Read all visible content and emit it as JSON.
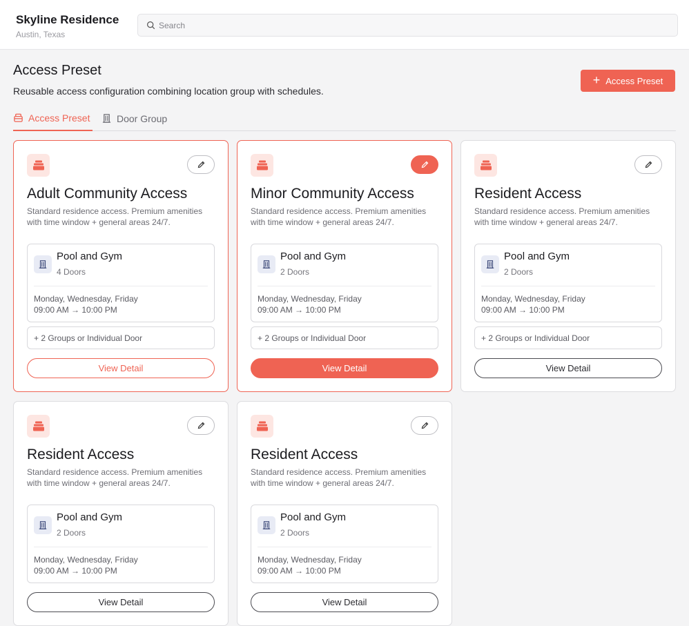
{
  "header": {
    "title": "Skyline Residence",
    "subtitle": "Austin, Texas",
    "search_placeholder": "Search"
  },
  "page": {
    "title": "Access Preset",
    "description": "Reusable access configuration combining location group with schedules.",
    "add_button_label": "Access Preset"
  },
  "tabs": [
    {
      "label": "Access Preset",
      "active": true
    },
    {
      "label": "Door Group",
      "active": false
    }
  ],
  "colors": {
    "accent": "#ef6353",
    "accent_soft": "#fde6e2"
  },
  "cards": [
    {
      "title": "Adult Community Access",
      "description": "Standard residence access. Premium amenities with time window + general areas 24/7.",
      "group_name": "Pool and Gym",
      "group_doors": "4 Doors",
      "schedule_days": "Monday, Wednesday, Friday",
      "schedule_time": "09:00 AM → 10:00 PM",
      "more": "+ 2 Groups or Individual Door",
      "detail_label": "View Detail"
    },
    {
      "title": "Minor Community Access",
      "description": "Standard residence access. Premium amenities with time window + general areas 24/7.",
      "group_name": "Pool and Gym",
      "group_doors": "2 Doors",
      "schedule_days": "Monday, Wednesday, Friday",
      "schedule_time": "09:00 AM → 10:00 PM",
      "more": "+ 2 Groups or Individual Door",
      "detail_label": "View Detail"
    },
    {
      "title": "Resident Access",
      "description": "Standard residence access. Premium amenities with time window + general areas 24/7.",
      "group_name": "Pool and Gym",
      "group_doors": "2 Doors",
      "schedule_days": "Monday, Wednesday, Friday",
      "schedule_time": "09:00 AM → 10:00 PM",
      "more": "+ 2 Groups or Individual Door",
      "detail_label": "View Detail"
    },
    {
      "title": "Resident Access",
      "description": "Standard residence access. Premium amenities with time window + general areas 24/7.",
      "group_name": "Pool and Gym",
      "group_doors": "2 Doors",
      "schedule_days": "Monday, Wednesday, Friday",
      "schedule_time": "09:00 AM → 10:00 PM",
      "detail_label": "View Detail"
    },
    {
      "title": "Resident Access",
      "description": "Standard residence access. Premium amenities with time window + general areas 24/7.",
      "group_name": "Pool and Gym",
      "group_doors": "2 Doors",
      "schedule_days": "Monday, Wednesday, Friday",
      "schedule_time": "09:00 AM → 10:00 PM",
      "detail_label": "View Detail"
    }
  ]
}
